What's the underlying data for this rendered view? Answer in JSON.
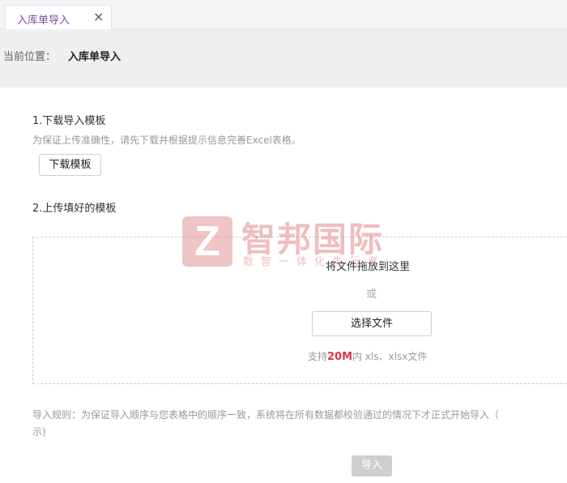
{
  "tabs": [
    {
      "label": "入库单导入",
      "close": "×"
    }
  ],
  "breadcrumb": {
    "label": "当前位置：",
    "current": "入库单导入"
  },
  "step1": {
    "title": "1.下载导入模板",
    "hint": "为保证上传准确性，请先下载并根据提示信息完善Excel表格。",
    "download_button": "下载模板"
  },
  "step2": {
    "title": "2.上传填好的模板"
  },
  "upload": {
    "drop_text": "将文件拖放到这里",
    "or_text": "或",
    "choose_button": "选择文件",
    "support_prefix": "支持",
    "support_size": "20M",
    "support_suffix": "内 xls、xlsx文件"
  },
  "rules": {
    "line1": "导入规则：为保证导入顺序与您表格中的顺序一致，系统将在所有数据都校验通过的情况下才正式开始导入（",
    "line2": "示)"
  },
  "import_button": "导入",
  "watermark": {
    "logo_letter": "Z",
    "name": "智邦国际",
    "slogan": "数智一体化先行者"
  },
  "colors": {
    "tab_active_text": "#7a4fa3",
    "highlight": "#e2334b",
    "disabled_button": "#cfcfd1"
  }
}
